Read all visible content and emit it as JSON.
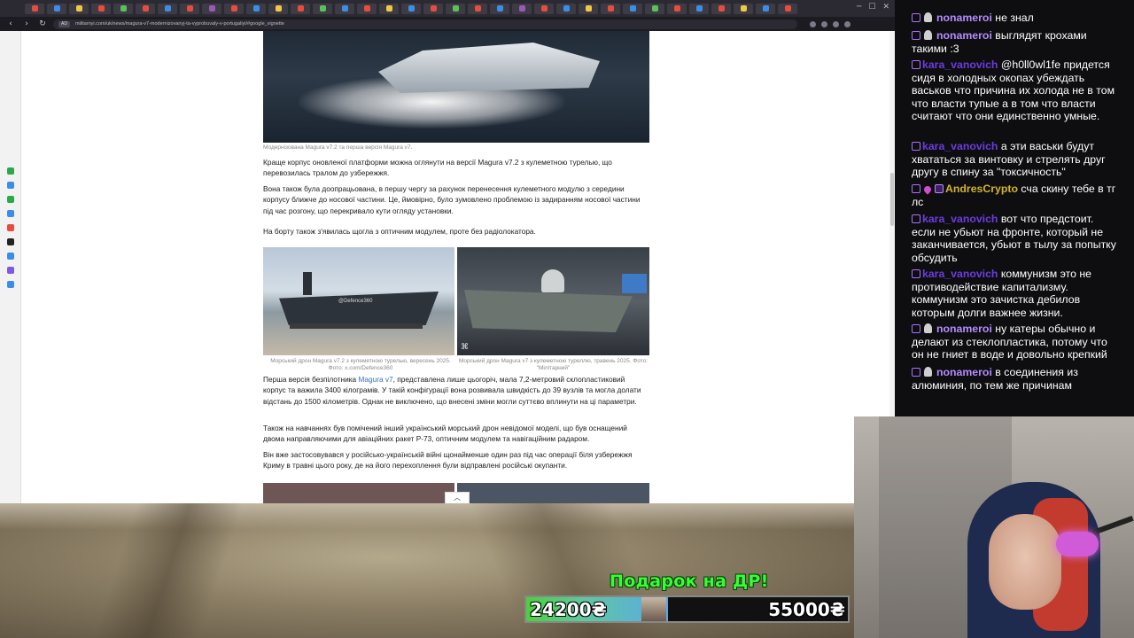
{
  "browser": {
    "url": "militarnyi.com/uk/news/magura-v7-modernizovanyj-ta-vyprobuvaly-v-portugaliyi/#google_vignette",
    "url_badge": "AD",
    "tab_colors": [
      "#e84c3d",
      "#3b8ee8",
      "#f2c744",
      "#e84c3d",
      "#5ac05a",
      "#e84c3d",
      "#3b8ee8",
      "#e84c3d",
      "#9b59b6",
      "#e84c3d",
      "#3b8ee8",
      "#f2c744",
      "#e84c3d",
      "#5ac05a",
      "#3b8ee8",
      "#e84c3d",
      "#f2c744",
      "#3b8ee8",
      "#e84c3d",
      "#5ac05a",
      "#e84c3d",
      "#3b8ee8",
      "#9b59b6",
      "#e84c3d",
      "#3b8ee8",
      "#f2c744",
      "#e84c3d",
      "#3b8ee8",
      "#5ac05a",
      "#e84c3d",
      "#3b8ee8",
      "#e84c3d",
      "#f2c744",
      "#3b8ee8",
      "#e84c3d"
    ],
    "nav_icons": [
      "back-icon",
      "forward-icon",
      "reload-icon"
    ],
    "window_controls": [
      "─",
      "☐",
      "✕"
    ]
  },
  "article": {
    "hero_caption": "Модернізована Magura v7.2 та перша версія Magura v7.",
    "p1": "Краще корпус оновленої платформи можна оглянути на версії Magura v7.2 з кулеметною турелью, що перевозилась тралом до узбережжя.",
    "p2": "Вона також була доопрацьована, в першу чергу за рахунок перенесення кулеметного модулю з середини корпусу ближче до носової частини. Це, ймовірно, було зумовлено проблемою із задиранням носової частини під час розгону, що перекривало кути огляду установки.",
    "p3": "На борту також з'явилась щогла з оптичним модулем, проте без радіолокатора.",
    "photo_left_watermark": "@Defence360",
    "photo_right_watermark": "⌘",
    "caption_left": "Морський дрон Magura v7.2 з кулеметною турелью, вересень 2025. Фото: x.com/Defence360",
    "caption_right": "Морський дрон Magura v7 з кулеметною туреллю, травень 2025. Фото: \"Мілітарний\"",
    "p4_pre": "Перша версія безпілотника ",
    "p4_link": "Magura v7",
    "p4_post": ", представлена лише цьогоріч, мала 7,2-метровий склопластиковий корпус та важила 3400 кілограмів. У такій конфігурації вона розвивала швидкість до 39 вузлів та могла долати відстань до 1500 кілометрів. Однак не виключено, що внесені зміни могли суттєво вплинути на ці параметри.",
    "p5": "Також на навчаннях був помічений інший український морський дрон невідомої моделі, що був оснащений двома направляючими для авіаційних ракет Р-73, оптичним модулем та навігаційним радаром.",
    "p6": "Він вже застосовувався у російсько-українській війні щонайменше один раз під час операції біля узбережжя Криму в травні цього року, де на його перехоплення були відправлені російські окупанти.",
    "up_button": "︿"
  },
  "donation": {
    "title": "Подарок на ДР!",
    "current": "24200₴",
    "goal": "55000₴",
    "progress_percent": 44
  },
  "chat": {
    "nick_colors": {
      "nonameroi": "#b48cff",
      "kara_vanovich": "#6a3ce0",
      "AndresCrypto": "#d4b52a"
    },
    "messages": [
      {
        "user": "nonameroi",
        "text": "не знал"
      },
      {
        "user": "nonameroi",
        "text": "выглядят крохами такими :3"
      },
      {
        "user": "kara_vanovich",
        "text": "@h0ll0wl1fe придется сидя в холодных окопах убеждать васьков что причина их холода не в том что власти тупые а в том что власти считают что они единственно умные."
      },
      {
        "user": "kara_vanovich",
        "text": "а эти васьки будут хвататься за винтовку и стрелять друг другу в спину за \"токсичность\""
      },
      {
        "user": "AndresCrypto",
        "text": "сча скину тебе в тг лс"
      },
      {
        "user": "kara_vanovich",
        "text": "вот что предстоит. если не убьют на фронте, который не заканчивается, убьют в тылу за попытку обсудить"
      },
      {
        "user": "kara_vanovich",
        "text": "коммунизм это не противодействие капитализму. коммунизм это зачистка дебилов которым долги важнее жизни."
      },
      {
        "user": "nonameroi",
        "text": "ну катеры обычно и делают из стеклопластика, потому что он не гниет в воде и довольно крепкий"
      },
      {
        "user": "nonameroi",
        "text": "в соединения из алюминия, по тем же причинам"
      }
    ]
  },
  "sidebar_icon_colors": [
    "#2aa84a",
    "#3b8ee8",
    "#2aa84a",
    "#3b8ee8",
    "#e84c3d",
    "#222222",
    "#3b8ee8",
    "#7b5ce0",
    "#3b8ee8"
  ]
}
